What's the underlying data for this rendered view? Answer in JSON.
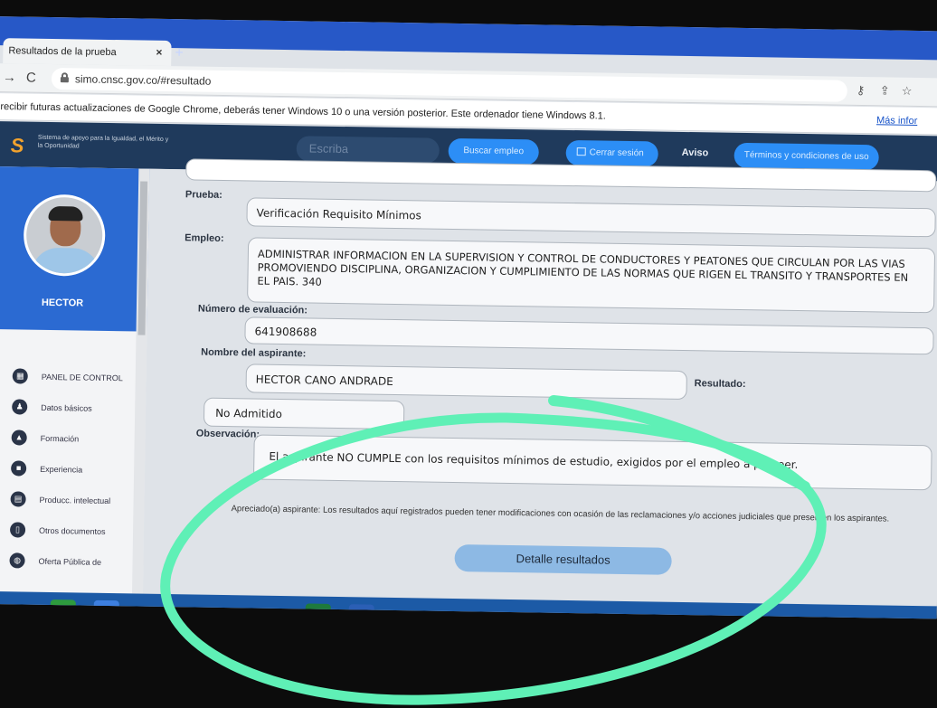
{
  "browser": {
    "tab_title": "Resultados de la prueba",
    "tab_close": "×",
    "new_tab": "+",
    "url": "simo.cnsc.gov.co/#resultado",
    "info_message": "recibir futuras actualizaciones de Google Chrome, deberás tener Windows 10 o una versión posterior. Este ordenador tiene Windows 8.1.",
    "info_link": "Más infor"
  },
  "site_header": {
    "logo_text": "Sistema de apoyo para la Igualdad, el Mérito y la Oportunidad",
    "search_placeholder": "Escriba",
    "search_button": "Buscar empleo",
    "logout_button": "Cerrar sesión",
    "notice_link": "Aviso",
    "terms_button": "Términos y condiciones de uso"
  },
  "sidebar": {
    "user_name": "HECTOR",
    "items": [
      {
        "label": "PANEL DE CONTROL",
        "icon": "dashboard-icon"
      },
      {
        "label": "Datos básicos",
        "icon": "users-icon"
      },
      {
        "label": "Formación",
        "icon": "graduation-cap-icon"
      },
      {
        "label": "Experiencia",
        "icon": "briefcase-icon"
      },
      {
        "label": "Producc. intelectual",
        "icon": "book-icon"
      },
      {
        "label": "Otros documentos",
        "icon": "document-icon"
      },
      {
        "label": "Oferta Pública de",
        "icon": "globe-icon"
      }
    ]
  },
  "result": {
    "prueba_label": "Prueba:",
    "prueba_value": "Verificación Requisito Mínimos",
    "empleo_label": "Empleo:",
    "empleo_value": "ADMINISTRAR INFORMACION EN LA SUPERVISION Y CONTROL DE CONDUCTORES Y PEATONES QUE CIRCULAN POR LAS VIAS PROMOVIENDO DISCIPLINA, ORGANIZACION Y CUMPLIMIENTO DE LAS NORMAS QUE RIGEN EL TRANSITO Y TRANSPORTES EN EL PAIS. 340",
    "evaluacion_label": "Número de evaluación:",
    "evaluacion_value": "641908688",
    "aspirante_label": "Nombre del aspirante:",
    "aspirante_value": "HECTOR CANO ANDRADE",
    "resultado_label": "Resultado:",
    "resultado_value": "No Admitido",
    "observacion_label": "Observación:",
    "observacion_value": "El aspirante NO CUMPLE con los requisitos mínimos de estudio, exigidos por el empleo a proveer.",
    "notice": "Apreciado(a) aspirante: Los resultados aquí registrados pueden tener modificaciones con ocasión de las reclamaciones y/o acciones judiciales que presenten los aspirantes.",
    "detail_button": "Detalle resultados"
  },
  "taskbar": {
    "apps": [
      {
        "glyph": "⊞",
        "icon": "windows-start-icon",
        "color": "#1c5aa6"
      },
      {
        "glyph": "■",
        "icon": "store-icon",
        "color": "#2e9b3e"
      },
      {
        "glyph": "◉",
        "icon": "chrome-icon",
        "color": "#3d7fe0"
      },
      {
        "glyph": "e",
        "icon": "internet-explorer-icon",
        "color": "#1c5aa6"
      },
      {
        "glyph": "●",
        "icon": "firefox-icon",
        "color": "#e8761e"
      },
      {
        "glyph": "✎",
        "icon": "paint-icon",
        "color": "#1c5aa6"
      },
      {
        "glyph": "X",
        "icon": "excel-icon",
        "color": "#1e7a3c"
      },
      {
        "glyph": "W",
        "icon": "word-icon",
        "color": "#2b5fb5"
      },
      {
        "glyph": "O",
        "icon": "opera-icon",
        "color": "#c8232c"
      }
    ]
  },
  "colors": {
    "marker": "#5ff0b6",
    "header_bg": "#1f3a5c",
    "accent_button": "#2c8ef6",
    "sidebar_profile": "#2b6ad2",
    "taskbar": "#1c5aa6"
  }
}
